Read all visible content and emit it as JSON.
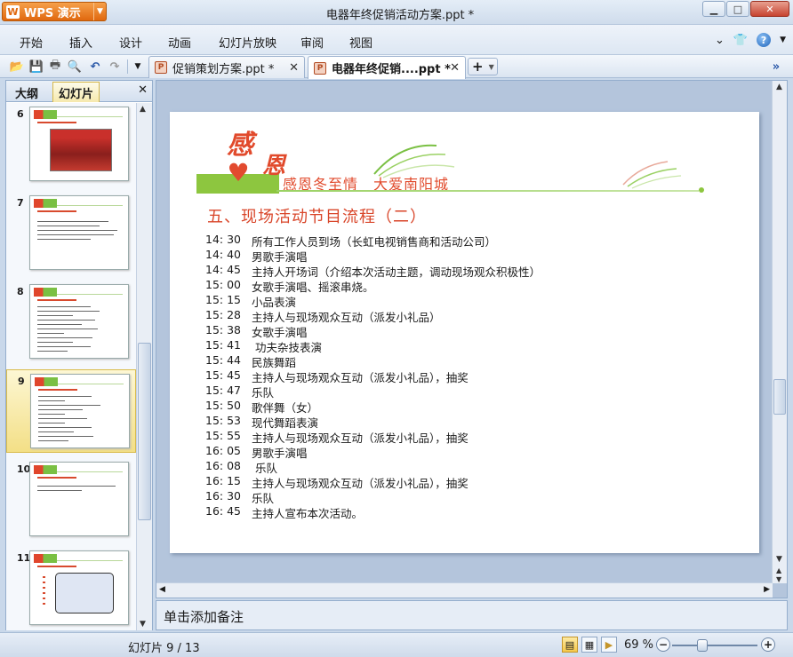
{
  "app": {
    "button_label": "WPS 演示",
    "logo_glyph": "W",
    "window_title": "电器年终促销活动方案.ppt *"
  },
  "menu": {
    "items": [
      "开始",
      "插入",
      "设计",
      "动画",
      "幻灯片放映",
      "审阅",
      "视图"
    ]
  },
  "tabs": [
    {
      "label": "促销策划方案.ppt *",
      "active": false
    },
    {
      "label": "电器年终促销....ppt *",
      "active": true
    }
  ],
  "left_panel": {
    "tabs": [
      "大纲",
      "幻灯片"
    ],
    "active_tab": "幻灯片",
    "slide_numbers": [
      "6",
      "7",
      "8",
      "9",
      "10",
      "11"
    ],
    "selected": "9"
  },
  "slide": {
    "logo_text_1": "感",
    "logo_text_2": "恩",
    "banner_text": "感恩冬至情　大爱南阳城",
    "title": "五、现场活动节目流程（二）",
    "schedule": [
      {
        "time": "14: 30",
        "item": "所有工作人员到场（长虹电视销售商和活动公司）"
      },
      {
        "time": "14: 40",
        "item": "男歌手演唱"
      },
      {
        "time": "14: 45",
        "item": "主持人开场词（介绍本次活动主题，调动现场观众积极性）"
      },
      {
        "time": "15: 00",
        "item": "女歌手演唱、摇滚串烧。"
      },
      {
        "time": "15: 15",
        "item": "小品表演"
      },
      {
        "time": "15: 28",
        "item": "主持人与现场观众互动（派发小礼品）"
      },
      {
        "time": "15: 38",
        "item": "女歌手演唱"
      },
      {
        "time": "15: 41",
        "item": " 功夫杂技表演"
      },
      {
        "time": "15: 44",
        "item": "民族舞蹈"
      },
      {
        "time": "15: 45",
        "item": "主持人与现场观众互动（派发小礼品），抽奖"
      },
      {
        "time": "15: 47",
        "item": "乐队"
      },
      {
        "time": "15: 50",
        "item": "歌伴舞（女）"
      },
      {
        "time": "15: 53",
        "item": "现代舞蹈表演"
      },
      {
        "time": "15: 55",
        "item": "主持人与现场观众互动（派发小礼品），抽奖"
      },
      {
        "time": "16: 05",
        "item": "男歌手演唱"
      },
      {
        "time": "16: 08",
        "item": " 乐队"
      },
      {
        "time": "16: 15",
        "item": "主持人与现场观众互动（派发小礼品），抽奖"
      },
      {
        "time": "16: 30",
        "item": "乐队"
      },
      {
        "time": "16: 45",
        "item": "主持人宣布本次活动。"
      }
    ]
  },
  "notes": {
    "placeholder": "单击添加备注"
  },
  "status": {
    "slide_indicator": "幻灯片 9 / 13",
    "zoom": "69 %",
    "zoom_fraction": 0.35
  },
  "colors": {
    "accent_red": "#e14a2c",
    "accent_green": "#8dc63f",
    "wps_orange": "#e0680e"
  }
}
